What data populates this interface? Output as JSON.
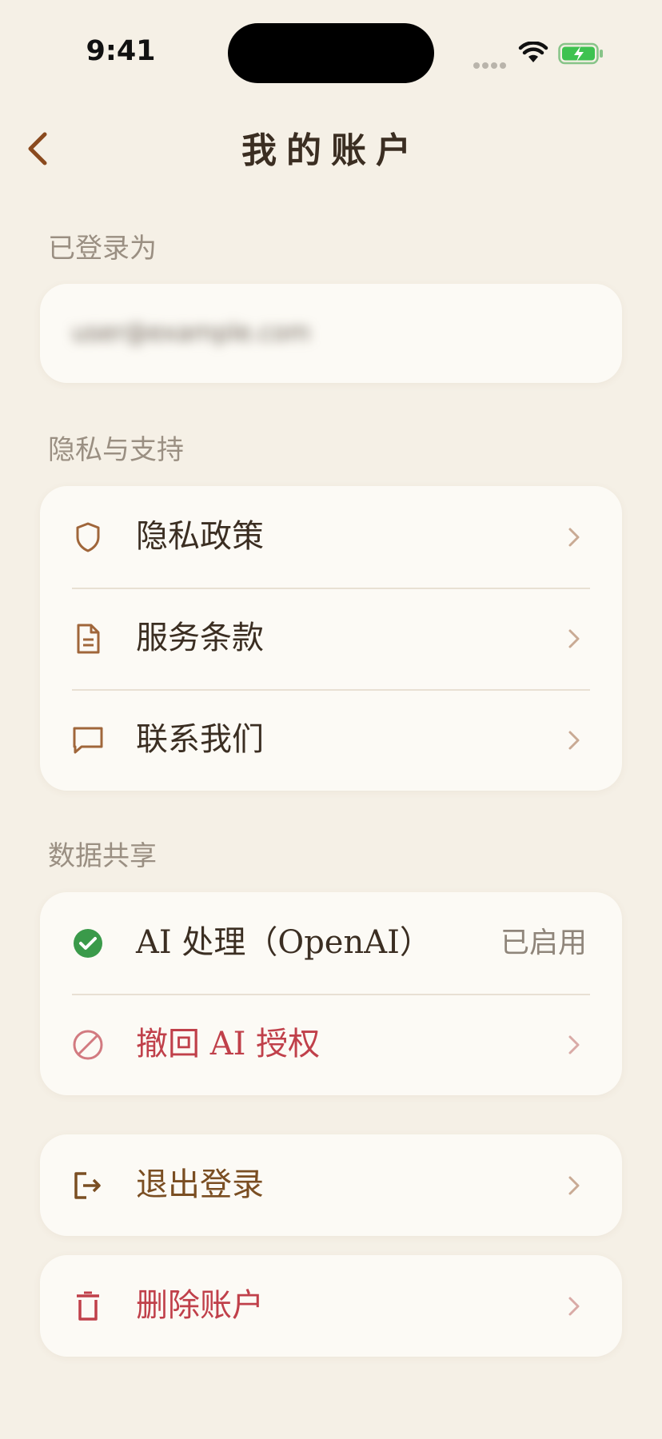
{
  "status_bar": {
    "time": "9:41"
  },
  "nav": {
    "title": "我的账户",
    "back_icon": "chevron-left-icon"
  },
  "account": {
    "section_label": "已登录为",
    "email_redacted": "user@example.com"
  },
  "privacy": {
    "section_label": "隐私与支持",
    "items": [
      {
        "label": "隐私政策",
        "icon": "shield-icon"
      },
      {
        "label": "服务条款",
        "icon": "document-icon"
      },
      {
        "label": "联系我们",
        "icon": "chat-bubble-icon"
      }
    ]
  },
  "data_sharing": {
    "section_label": "数据共享",
    "ai_processing": {
      "label": "AI 处理（OpenAI）",
      "status": "已启用",
      "icon": "check-circle-icon"
    },
    "revoke": {
      "label": "撤回 AI 授权",
      "icon": "prohibited-icon"
    }
  },
  "logout": {
    "label": "退出登录",
    "icon": "logout-icon"
  },
  "delete_account": {
    "label": "删除账户",
    "icon": "trash-icon"
  },
  "colors": {
    "background": "#f5f0e6",
    "card": "#fcfaf5",
    "accent_brown": "#a0663a",
    "danger_red": "#c0404a",
    "success_green": "#3a9a4a"
  }
}
